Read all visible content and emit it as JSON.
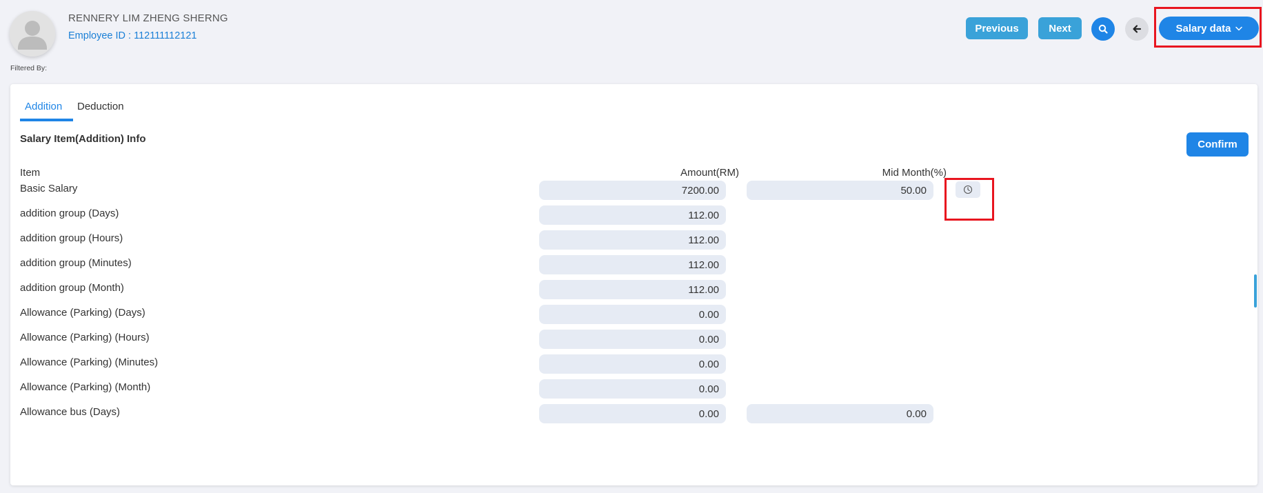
{
  "header": {
    "employee_name": "RENNERY LIM ZHENG SHERNG",
    "employee_id": "Employee ID : 112111112121",
    "filtered_by": "Filtered By:",
    "previous_label": "Previous",
    "next_label": "Next",
    "salary_data_label": "Salary data"
  },
  "tabs": [
    {
      "label": "Addition",
      "active": true
    },
    {
      "label": "Deduction",
      "active": false
    }
  ],
  "section_title": "Salary Item(Addition) Info",
  "confirm_label": "Confirm",
  "columns": {
    "item": "Item",
    "amount": "Amount(RM)",
    "mid_month": "Mid Month(%)"
  },
  "rows": [
    {
      "label": "Basic Salary",
      "amount": "7200.00",
      "mid_month": "50.00",
      "history": true
    },
    {
      "label": "addition group (Days)",
      "amount": "112.00"
    },
    {
      "label": "addition group (Hours)",
      "amount": "112.00"
    },
    {
      "label": "addition group (Minutes)",
      "amount": "112.00"
    },
    {
      "label": "addition group (Month)",
      "amount": "112.00"
    },
    {
      "label": "Allowance (Parking) (Days)",
      "amount": "0.00"
    },
    {
      "label": "Allowance (Parking) (Hours)",
      "amount": "0.00"
    },
    {
      "label": "Allowance (Parking) (Minutes)",
      "amount": "0.00"
    },
    {
      "label": "Allowance (Parking) (Month)",
      "amount": "0.00"
    },
    {
      "label": "Allowance bus (Days)",
      "amount": "0.00",
      "mid_month": "0.00"
    }
  ],
  "colors": {
    "primary": "#1f85e6",
    "secondary": "#3aa2d9",
    "highlight": "#e8151f",
    "field_bg": "#e6ebf4"
  },
  "icons": {
    "search": "search-icon",
    "back": "arrow-left-icon",
    "dropdown": "chevron-down-icon",
    "history": "clock-icon",
    "avatar": "user-avatar-icon"
  }
}
